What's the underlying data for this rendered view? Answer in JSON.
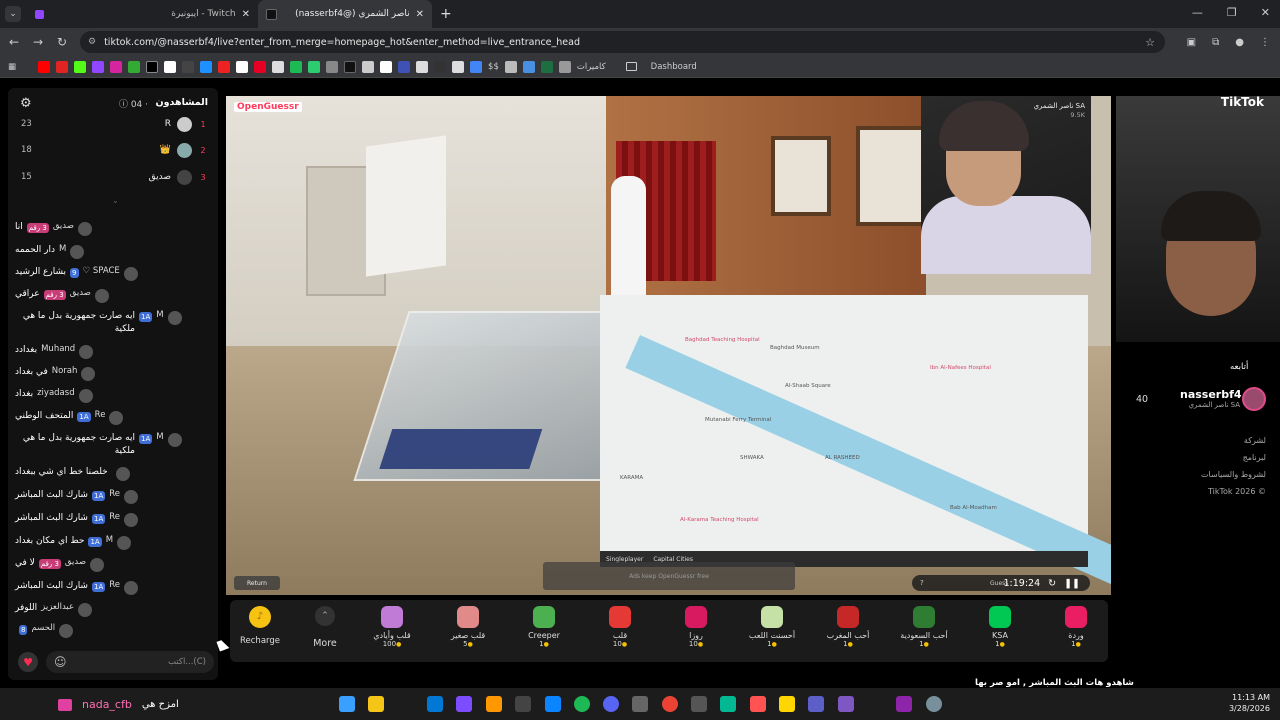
{
  "browser": {
    "tabs": [
      {
        "title": "Twitch - ايبونيرة",
        "active": false,
        "color": "#9146ff"
      },
      {
        "title": "ناصر الشمري (@nasserbf4)",
        "active": true,
        "color": "#111111"
      }
    ],
    "url": "tiktok.com/@nasserbf4/live?enter_from_merge=homepage_hot&enter_method=live_entrance_head",
    "bookmarks": [
      {
        "label": "$$"
      },
      {
        "label": "كاميرات"
      },
      {
        "label": "Dashboard"
      }
    ]
  },
  "viewers": {
    "title": "المشاهدون",
    "count": "04 ·",
    "ranking": [
      {
        "pos": "1",
        "name": "R",
        "score": "23"
      },
      {
        "pos": "2",
        "name": "",
        "score": "18"
      },
      {
        "pos": "3",
        "name": "صديق",
        "score": "15"
      }
    ]
  },
  "chat": [
    {
      "user": "صديق",
      "badge": "3 رقم",
      "badge_color": "pink",
      "msg": "انا"
    },
    {
      "user": "M",
      "badge": "",
      "badge_color": "",
      "msg": "دار الحممه"
    },
    {
      "user": "SPACE ♡",
      "badge": "9",
      "badge_color": "blue",
      "msg": "بشارع الرشيد"
    },
    {
      "user": "صديق",
      "badge": "3 رقم",
      "badge_color": "pink",
      "msg": "عراقي"
    },
    {
      "user": "M",
      "badge": "1A",
      "badge_color": "blue",
      "msg": "ايه صارت جمهورية بدل ما هي ملكية"
    },
    {
      "user": "Muhand",
      "badge": "",
      "badge_color": "",
      "msg": "بغدادد"
    },
    {
      "user": "Norah",
      "badge": "",
      "badge_color": "",
      "msg": "في بغداد"
    },
    {
      "user": "ziyadasd",
      "badge": "",
      "badge_color": "",
      "msg": "بغداد"
    },
    {
      "user": "Re",
      "badge": "1A",
      "badge_color": "blue",
      "msg": "المتحف الوطني"
    },
    {
      "user": "M",
      "badge": "1A",
      "badge_color": "blue",
      "msg": "ايه صارت جمهورية بدل ما هي ملكية"
    },
    {
      "user": "",
      "badge": "",
      "badge_color": "",
      "msg": "خلصنا خط اي شي ببغداد"
    },
    {
      "user": "Re",
      "badge": "1A",
      "badge_color": "blue",
      "msg": "شارك البث المباشر"
    },
    {
      "user": "Re",
      "badge": "1A",
      "badge_color": "blue",
      "msg": "شارك البث المباشر"
    },
    {
      "user": "M",
      "badge": "1A",
      "badge_color": "blue",
      "msg": "حط اي مكان بغداد"
    },
    {
      "user": "صديق",
      "badge": "3 رقم",
      "badge_color": "pink",
      "msg": "لا في"
    },
    {
      "user": "Re",
      "badge": "1A",
      "badge_color": "blue",
      "msg": "شارك البث المباشر"
    },
    {
      "user": "عبدالعزيز",
      "badge": "",
      "badge_color": "",
      "msg": "اللوفر"
    },
    {
      "user": "الحسم",
      "badge": "8",
      "badge_color": "blue",
      "msg": ""
    }
  ],
  "chat_input": {
    "placeholder": "اكتب...(C)"
  },
  "stream": {
    "game_badge": "OpenGuessr",
    "streamer_name": "ناصر الشمري",
    "streamer_country": "SA",
    "likes": "9.5K",
    "map_mode": "Singleplayer",
    "map_set": "Capital Cities",
    "guess_hint": "Ads keep OpenGuessr free",
    "timer": "1:19:24",
    "guess_label": "Guess",
    "return_label": "Return",
    "map_labels": [
      {
        "t": "Baghdad Teaching Hospital",
        "red": true
      },
      {
        "t": "Al-Shaab Square",
        "red": false
      },
      {
        "t": "Baghdad Museum",
        "red": false
      },
      {
        "t": "Mutanabi Ferry Terminal",
        "red": false
      },
      {
        "t": "SHWAKA",
        "red": false
      },
      {
        "t": "AL RASHEED",
        "red": false
      },
      {
        "t": "Ibn Al-Nafees Hospital",
        "red": true
      },
      {
        "t": "Al-Karama Teaching Hospital",
        "red": true
      },
      {
        "t": "KARAMA",
        "red": false
      },
      {
        "t": "Bab Al-Moadham",
        "red": false
      }
    ]
  },
  "gifts": {
    "recharge": "Recharge",
    "more": "More",
    "items": [
      {
        "name": "قلب وأيادي",
        "price": "100",
        "color": "#c07bd6"
      },
      {
        "name": "قلب صغير",
        "price": "5",
        "color": "#e08a8a"
      },
      {
        "name": "Creeper",
        "price": "1",
        "color": "#4caf50"
      },
      {
        "name": "قلب",
        "price": "10",
        "color": "#e53935"
      },
      {
        "name": "روزا",
        "price": "10",
        "color": "#d81b60"
      },
      {
        "name": "أحسنت اللعب",
        "price": "1",
        "color": "#c5e1a5"
      },
      {
        "name": "أحب المغرب",
        "price": "1",
        "color": "#c62828"
      },
      {
        "name": "أحب السعودية",
        "price": "1",
        "color": "#2e7d32"
      },
      {
        "name": "KSA",
        "price": "1",
        "color": "#00c853"
      },
      {
        "name": "وردة",
        "price": "1",
        "color": "#e91e63"
      }
    ]
  },
  "creator": {
    "name": "nasserbf4",
    "sub": "ناصر الشمري SA",
    "follow_label": "أتابعه",
    "count": "40"
  },
  "footer_links": [
    "لشركة",
    "لبرنامج",
    "لشروط والسياسات",
    "TikTok 2026 ©"
  ],
  "caption": "شاهدو هات البث المباشر , امو صر بها",
  "taskbar": {
    "user": "nada_cfb",
    "message": "امزح هي",
    "time": "11:13 AM",
    "date": "3/28/2026"
  },
  "brand": {
    "tiktok_logo": "TikTok"
  }
}
